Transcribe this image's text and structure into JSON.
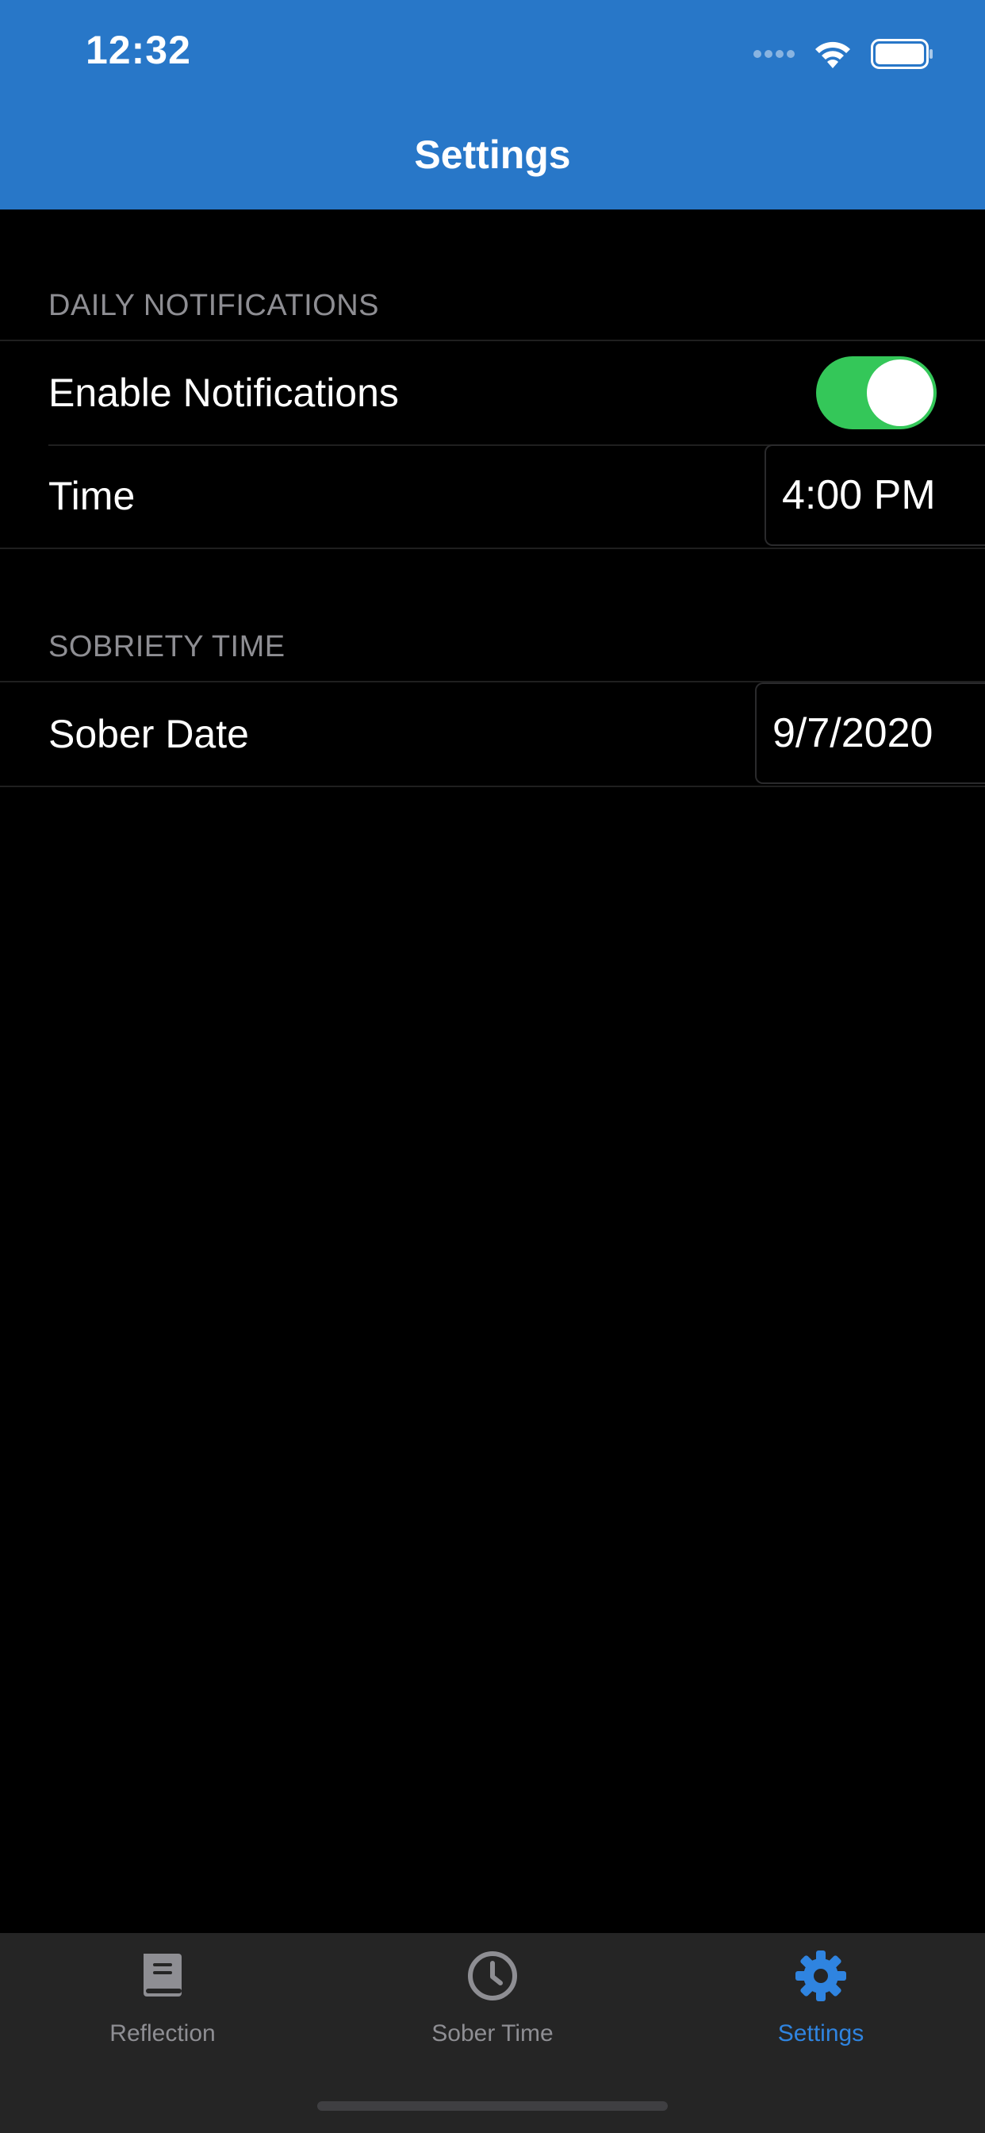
{
  "status_bar": {
    "time": "12:32"
  },
  "nav": {
    "title": "Settings"
  },
  "sections": {
    "daily_notifications": {
      "header": "DAILY NOTIFICATIONS",
      "enable_label": "Enable Notifications",
      "enable_value": true,
      "time_label": "Time",
      "time_value": "4:00 PM"
    },
    "sobriety_time": {
      "header": "SOBRIETY TIME",
      "sober_date_label": "Sober Date",
      "sober_date_value": "9/7/2020"
    }
  },
  "tabbar": {
    "tabs": [
      {
        "label": "Reflection",
        "icon": "book-icon",
        "active": false
      },
      {
        "label": "Sober Time",
        "icon": "clock-icon",
        "active": false
      },
      {
        "label": "Settings",
        "icon": "gear-icon",
        "active": true
      }
    ]
  },
  "colors": {
    "header_bg": "#2877c8",
    "toggle_on": "#34c759",
    "tab_active": "#2f84e0",
    "tab_inactive": "#8e8e93"
  }
}
